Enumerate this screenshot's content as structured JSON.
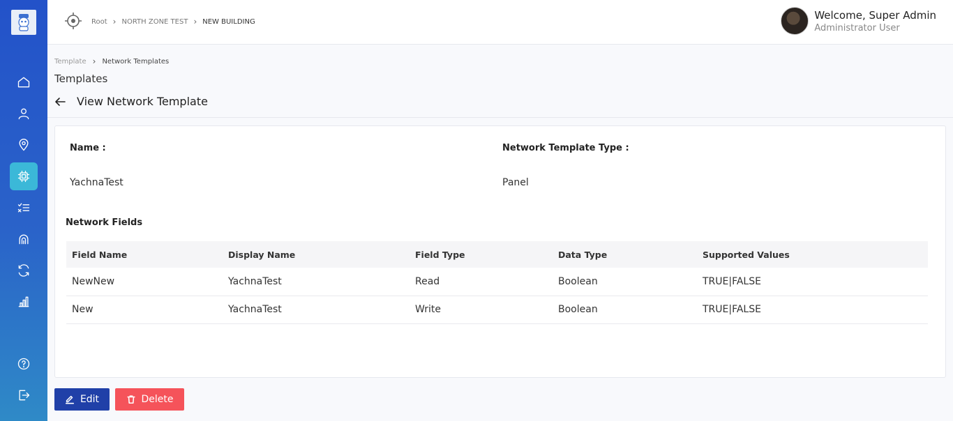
{
  "topbar": {
    "breadcrumb": [
      "Root",
      "NORTH ZONE TEST",
      "NEW BUILDING"
    ],
    "welcome": "Welcome, Super Admin",
    "role": "Administrator User"
  },
  "sidebar": {
    "items": [
      {
        "icon": "home-icon"
      },
      {
        "icon": "user-icon"
      },
      {
        "icon": "location-pin-icon"
      },
      {
        "icon": "chip-icon",
        "active": true
      },
      {
        "icon": "checklist-icon"
      },
      {
        "icon": "signal-icon"
      },
      {
        "icon": "sync-icon"
      },
      {
        "icon": "bar-chart-icon"
      },
      {
        "icon": "help-icon"
      },
      {
        "icon": "logout-icon"
      }
    ]
  },
  "page": {
    "breadcrumb": [
      "Template",
      "Network Templates"
    ],
    "section_title": "Templates",
    "view_title": "View Network Template"
  },
  "details": {
    "name_label": "Name :",
    "name_value": "YachnaTest",
    "type_label": "Network Template Type :",
    "type_value": "Panel",
    "fields_title": "Network Fields"
  },
  "table": {
    "headers": [
      "Field Name",
      "Display Name",
      "Field Type",
      "Data Type",
      "Supported Values"
    ],
    "rows": [
      [
        "NewNew",
        "YachnaTest",
        "Read",
        "Boolean",
        "TRUE|FALSE"
      ],
      [
        "New",
        "YachnaTest",
        "Write",
        "Boolean",
        "TRUE|FALSE"
      ]
    ]
  },
  "actions": {
    "edit_label": "Edit",
    "delete_label": "Delete"
  },
  "colors": {
    "sidebar": "#2352c9",
    "active_item": "#3bb8d8",
    "edit_button": "#2040a8",
    "delete_button": "#f5535a"
  }
}
